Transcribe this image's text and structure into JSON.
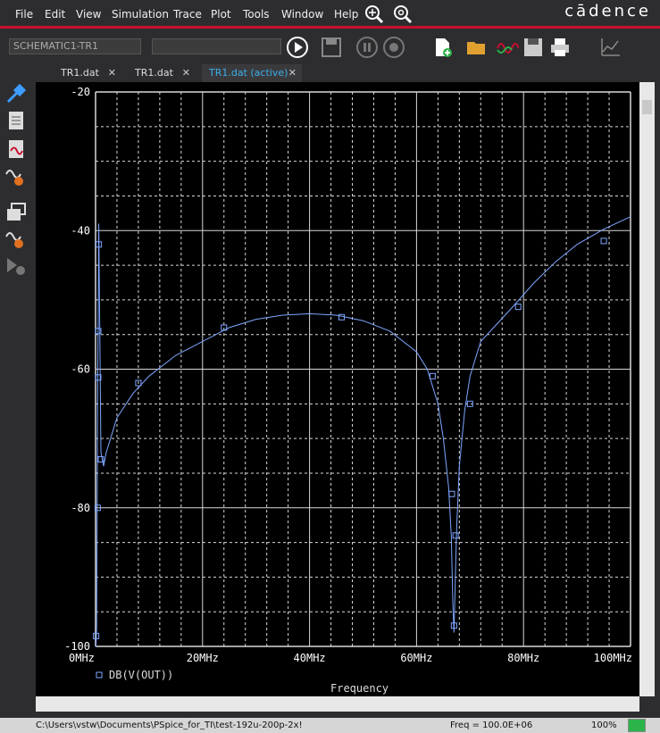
{
  "menu": {
    "items": [
      "File",
      "Edit",
      "View",
      "Simulation",
      "Trace",
      "Plot",
      "Tools",
      "Window",
      "Help"
    ],
    "brand": "cādence"
  },
  "toolbar": {
    "profile_value": "SCHEMATIC1-TR1",
    "search_value": ""
  },
  "tabs": [
    {
      "label": "TR1.dat"
    },
    {
      "label": "TR1.dat"
    },
    {
      "label": "TR1.dat (active)"
    }
  ],
  "status": {
    "path": "C:\\Users\\vstw\\Documents\\PSpice_for_TI\\test-192u-200p-2x!",
    "freq": "Freq =  100.0E+06",
    "zoom": "100%",
    "progress_fraction": 1.0
  },
  "colors": {
    "trace": "#7ea6ff",
    "grid": "#d8d8d8",
    "axis_text": "#ffffff",
    "accent_red": "#c8102e",
    "status_green": "#2cb34a"
  },
  "chart_data": {
    "type": "line",
    "xlabel": "Frequency",
    "ylabel": "",
    "xlim": [
      0,
      100
    ],
    "ylim": [
      -100,
      -20
    ],
    "x_ticks": [
      "0MHz",
      "20MHz",
      "40MHz",
      "60MHz",
      "80MHz",
      "100MHz"
    ],
    "y_ticks": [
      "-20",
      "-40",
      "-60",
      "-80",
      "-100"
    ],
    "grid": true,
    "legend": "bottom-left",
    "series": [
      {
        "name": "DB(V(OUT))",
        "x": [
          0.08,
          0.2,
          0.3,
          0.4,
          0.5,
          0.6,
          1.0,
          1.5,
          2,
          4,
          7,
          10,
          15,
          20,
          25,
          30,
          35,
          40,
          45,
          50,
          55,
          60,
          62,
          64,
          65,
          66,
          66.5,
          66.8,
          67,
          67.2,
          67.5,
          68,
          69,
          70,
          72,
          75,
          78,
          82,
          86,
          90,
          95,
          100
        ],
        "y": [
          -100,
          -97,
          -80,
          -61,
          -53,
          -39,
          -72,
          -74,
          -72,
          -67,
          -63.5,
          -61,
          -58,
          -56,
          -54,
          -52.8,
          -52.2,
          -52,
          -52.2,
          -53,
          -54.5,
          -57.5,
          -60,
          -65,
          -70,
          -77,
          -84,
          -94,
          -98,
          -92,
          -83,
          -74,
          -66,
          -61,
          -56,
          -53.5,
          -51,
          -47.5,
          -44.5,
          -42,
          -39.8,
          -38
        ]
      }
    ],
    "markers": [
      {
        "x": 0.1,
        "y": -98.5
      },
      {
        "x": 0.4,
        "y": -80
      },
      {
        "x": 0.5,
        "y": -61.2
      },
      {
        "x": 0.5,
        "y": -54.5
      },
      {
        "x": 0.6,
        "y": -42
      },
      {
        "x": 1.0,
        "y": -73
      },
      {
        "x": 8,
        "y": -62
      },
      {
        "x": 24,
        "y": -54
      },
      {
        "x": 46,
        "y": -52.5
      },
      {
        "x": 63,
        "y": -61
      },
      {
        "x": 66.6,
        "y": -78
      },
      {
        "x": 67.3,
        "y": -84
      },
      {
        "x": 67,
        "y": -97
      },
      {
        "x": 70,
        "y": -65
      },
      {
        "x": 79,
        "y": -51
      },
      {
        "x": 95,
        "y": -41.5
      }
    ]
  }
}
